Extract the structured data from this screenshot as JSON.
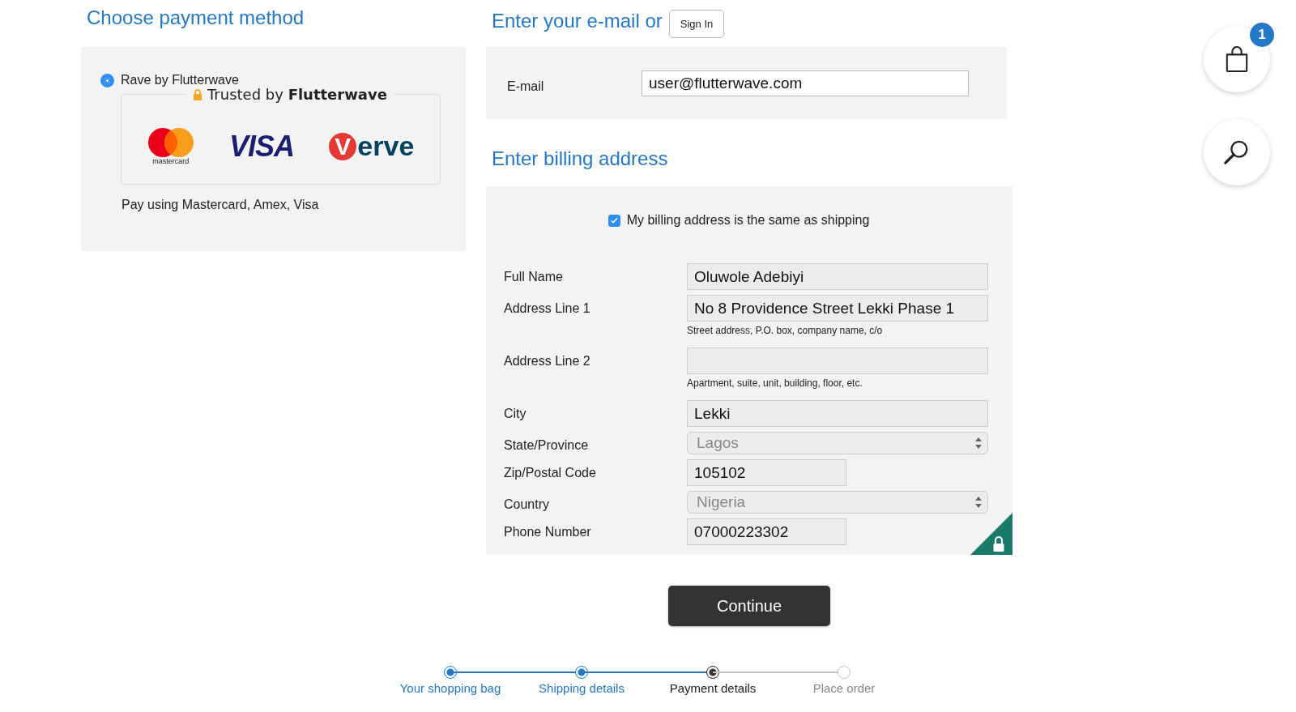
{
  "payment": {
    "heading": "Choose payment method",
    "methods": [
      {
        "label": "Rave by Flutterwave",
        "selected": true,
        "trust_text": "Trusted by **Flutterwave**",
        "logos": [
          {
            "kind": "mastercard",
            "text": "mastercard"
          },
          {
            "kind": "visa",
            "text": "VISA"
          },
          {
            "kind": "verve",
            "badge": "V",
            "text": "erve"
          }
        ],
        "description": "Pay using Mastercard, Amex, Visa"
      }
    ]
  },
  "email": {
    "heading": "Enter your e-mail or",
    "sign_in": "Sign In",
    "label": "E-mail",
    "value": "user@flutterwave.com"
  },
  "billing": {
    "heading": "Enter billing address",
    "same_as_shipping": {
      "label": "My billing address is the same as shipping",
      "checked": true
    },
    "fields": [
      {
        "label": "Full Name",
        "kind": "text",
        "value": "Oluwole Adebiyi"
      },
      {
        "label": "Address Line 1",
        "kind": "text",
        "value": "No 8 Providence Street Lekki Phase 1",
        "hint": "Street address, P.O. box, company name, c/o"
      },
      {
        "label": "Address Line 2",
        "kind": "text",
        "hint": "Apartment, suite, unit, building, floor, etc."
      },
      {
        "label": "City",
        "kind": "text",
        "value": "Lekki"
      },
      {
        "label": "State/Province",
        "kind": "select",
        "value": "Lagos",
        "disabled": true
      },
      {
        "label": "Zip/Postal Code",
        "kind": "short",
        "value": "105102"
      },
      {
        "label": "Country",
        "kind": "select",
        "value": "Nigeria",
        "disabled": true
      },
      {
        "label": "Phone Number",
        "kind": "short",
        "value": "07000223302"
      }
    ]
  },
  "continue_button": "Continue",
  "steps": [
    {
      "label": "Your shopping bag",
      "done": true,
      "current": false
    },
    {
      "label": "Shipping details",
      "done": true,
      "current": false
    },
    {
      "label": "Payment details",
      "done": false,
      "current": true
    },
    {
      "label": "Place order",
      "done": false,
      "current": false
    }
  ],
  "cart": {
    "count": "1"
  }
}
